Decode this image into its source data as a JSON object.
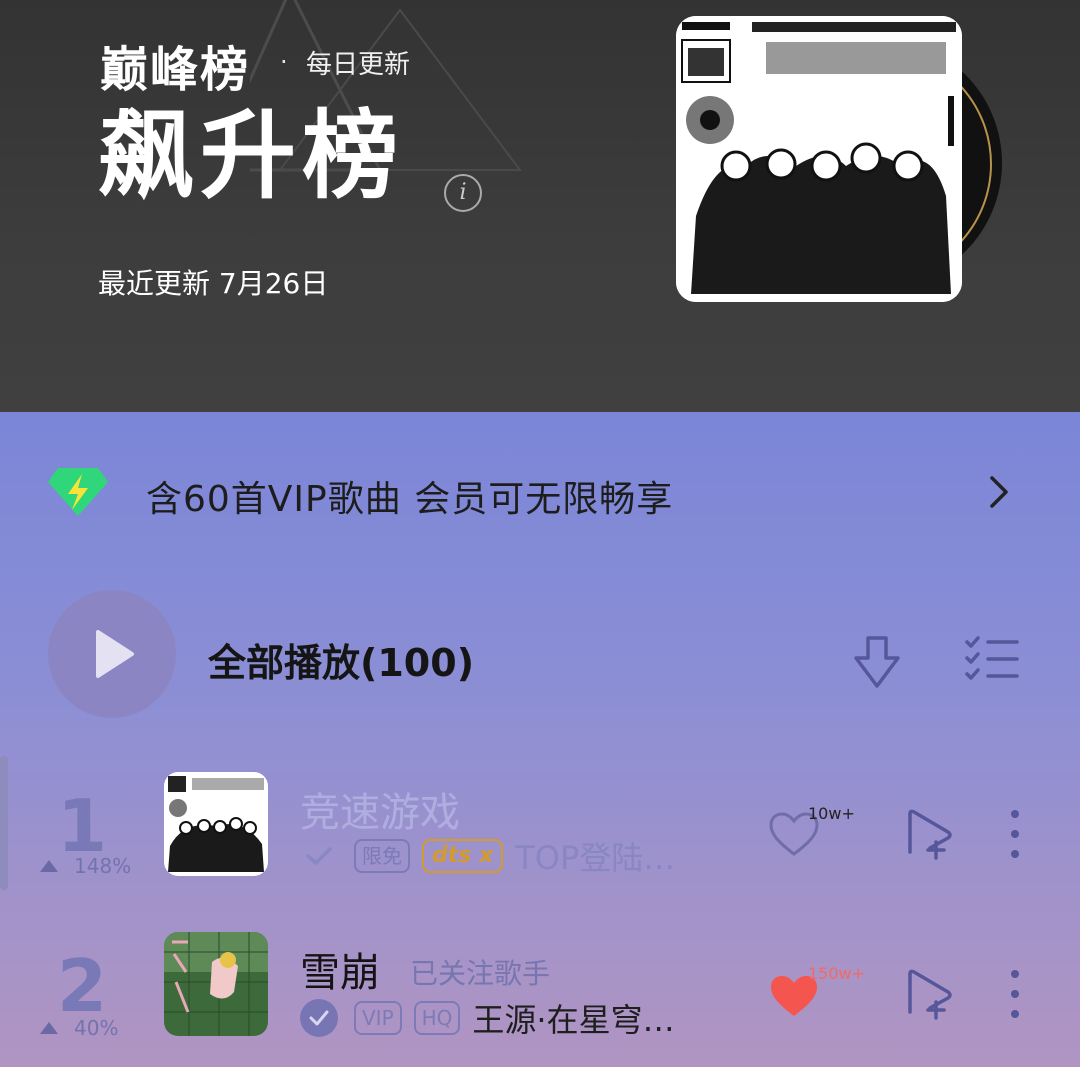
{
  "header": {
    "brand": "巅峰榜",
    "separator": "·",
    "brand_sub": "每日更新",
    "title": "飙升榜",
    "info": "i",
    "updated": "最近更新 7月26日"
  },
  "vip_banner": {
    "text": "含60首VIP歌曲 会员可无限畅享"
  },
  "play_all": {
    "label": "全部播放(100)"
  },
  "songs": [
    {
      "rank": "1",
      "change": "148%",
      "title": "竞速游戏",
      "badges": [
        "限免",
        "dts x"
      ],
      "artist": "TOP登陆…",
      "likes": "10w+",
      "liked": false
    },
    {
      "rank": "2",
      "change": "40%",
      "title": "雪崩",
      "follow": "已关注歌手",
      "badges": [
        "VIP",
        "HQ"
      ],
      "artist": "王源·在星穹…",
      "likes": "150w+",
      "liked": true
    }
  ],
  "colors": {
    "liked_heart": "#f4554f",
    "dts_badge": "#d49a2e",
    "accent_purple": "#7a79b8"
  }
}
